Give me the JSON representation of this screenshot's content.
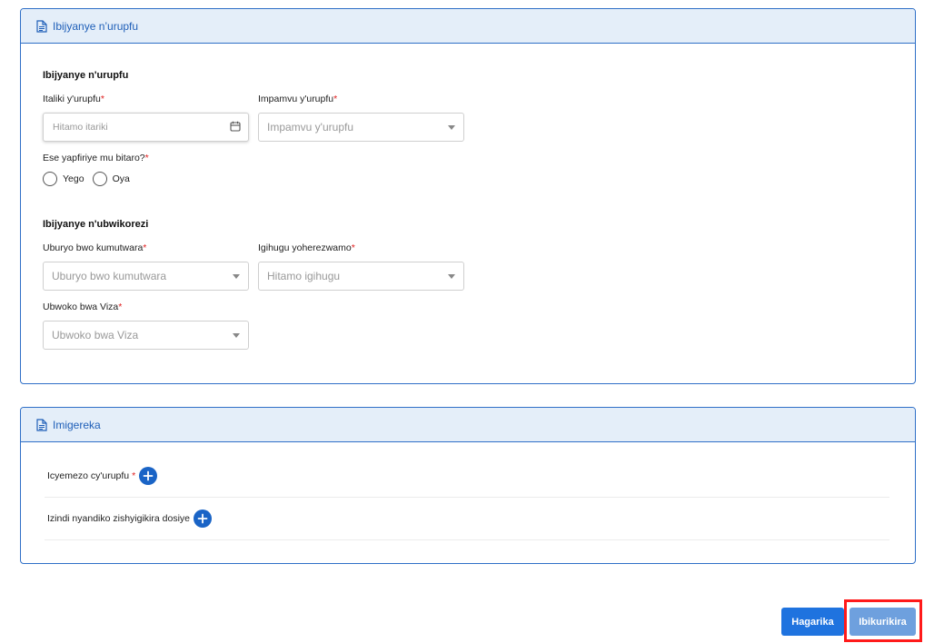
{
  "death_card": {
    "header": "Ibijyanye n’urupfu",
    "section_title": "Ibijyanye n'urupfu",
    "date_label": "Italiki y'urupfu",
    "date_placeholder": "Hitamo itariki",
    "cause_label": "Impamvu y'urupfu",
    "cause_placeholder": "Impamvu y'urupfu",
    "hospital_label": "Ese yapfiriye mu bitaro?",
    "yes_label": "Yego",
    "no_label": "Oya",
    "transport_section_title": "Ibijyanye n'ubwikorezi",
    "transport_label": "Uburyo bwo kumutwara",
    "transport_placeholder": "Uburyo bwo kumutwara",
    "country_label": "Igihugu yoherezwamo",
    "country_placeholder": "Hitamo igihugu",
    "visa_label": "Ubwoko bwa Viza",
    "visa_placeholder": "Ubwoko bwa Viza",
    "required_mark": "*"
  },
  "attachments_card": {
    "header": "Imigereka",
    "items": [
      {
        "label": "Icyemezo cy'urupfu",
        "required": "*"
      },
      {
        "label": "Izindi nyandiko zishyigikira dosiye"
      }
    ]
  },
  "actions": {
    "cancel_label": "Hagarika",
    "submit_label": "Ibikurikira"
  },
  "colors": {
    "primary": "#1f73df",
    "header_bg": "#e4eef9",
    "required": "#e02020",
    "highlight": "#ff1a1a"
  }
}
